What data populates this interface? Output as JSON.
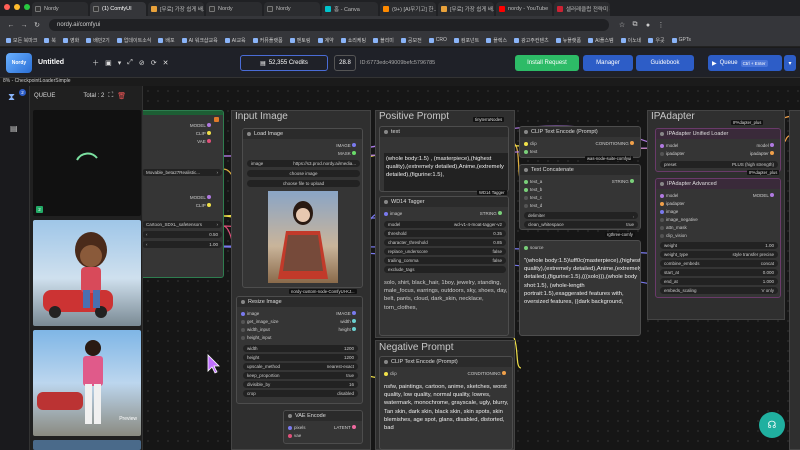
{
  "browser": {
    "tabs": [
      "Nordy",
      "(1) ComfyUI",
      "[무료] 가장 쉽게 배...",
      "Nordy",
      "Nordy",
      "홈 - Canva",
      "(9+) [AI무기고] 한...",
      "[무료] 가장 쉽게 배...",
      "nordy - YouTube",
      "셀러레클럽 전략미 사..."
    ],
    "url": "nordy.ai/comfyui",
    "bookmarks": [
      "모든 북마크",
      "북",
      "영화",
      "배민2기",
      "업데이트소식",
      "배포",
      "AI 워크샵교육",
      "AI교육",
      "커뮤플랫폼",
      "멘토링",
      "계약",
      "쇼리케팅",
      "블리미",
      "공모전",
      "CRO",
      "컴포넌트",
      "플렉스",
      "광고주컨텐츠",
      "뉴플랫폼",
      "AI플스템",
      "이노네",
      "우곳",
      "GPTs"
    ]
  },
  "app": {
    "logo_text": "Nordy",
    "title": "Untitled",
    "credits": "52,355 Credits",
    "zoom": "28.8",
    "id_text": "ID:6773edc49009befc5796785",
    "install_request": "Install Request",
    "manager": "Manager",
    "guidebook": "Guidebook",
    "queue_label": "Queue",
    "queue_shortcut": "Ctrl + Enter",
    "status_line": "8% - CheckpointLoaderSimple"
  },
  "queue_panel": {
    "title": "QUEUE",
    "total": "Total : 2",
    "badge": "2",
    "preview_label": "Preview"
  },
  "nodes": {
    "left_partial": {
      "outputs": [
        "MODEL",
        "CLIP",
        "VAE"
      ],
      "ckpt_value": "Movable_beta27Realistic...",
      "outputs2": [
        "MODEL",
        "CLIP"
      ],
      "ckpt2_value": "Cartoon_SDXL_safetensors",
      "val1": "0.50",
      "val2": "1.00"
    },
    "input_image": {
      "group_title": "Input Image",
      "load_title": "Load Image",
      "outputs": [
        "IMAGE",
        "MASK"
      ],
      "image_label": "image",
      "image_value": "https://s3.prod.nordy.ai/media...",
      "btn_choose": "choose image",
      "btn_upload": "choose file to upload",
      "custom_tag": "nordy-custom-node-ComfyUI-KJ...",
      "resize_title": "Resize Image",
      "resize_inputs": [
        "image",
        "get_image_size",
        "width_input",
        "height_input"
      ],
      "resize_outputs": [
        "IMAGE",
        "width",
        "height"
      ],
      "w_label": "width",
      "w_val": "1200",
      "h_label": "height",
      "h_val": "1200",
      "upscale_label": "upscale_method",
      "upscale_val": "nearest-exact",
      "keep_label": "keep_proportion",
      "keep_val": "true",
      "div_label": "divisible_by",
      "div_val": "16",
      "crop_label": "crop",
      "crop_val": "disabled",
      "vae_title": "VAE Encode",
      "vae_inputs": [
        "pixels",
        "vae"
      ],
      "vae_output": "LATENT"
    },
    "positive": {
      "group_title": "Positive Prompt",
      "text_title": "text",
      "tag": "tinyterraNodes",
      "text": "(whole body:1.5) , (masterpiece),(highest quality),(extremely detailed),Anime,(extremely detailed),(figurine:1.5),",
      "wd14_title": "WD14 Tagger",
      "wd14_tag": "WD14 Tagger",
      "wd_image": "image",
      "wd_output": "STRING",
      "model_label": "model",
      "model_val": "wd-v1-4-moat-tagger-v2",
      "thr_label": "threshold",
      "thr_val": "0.35",
      "cthr_label": "character_threshold",
      "cthr_val": "0.85",
      "rep_label": "replace_underscore",
      "rep_val": "false",
      "trail_label": "trailing_comma",
      "trail_val": "false",
      "excl_label": "exclude_tags",
      "tags_text": "solo, shirt, black_hair, 1boy, jewelry, standing, male_focus, earrings, outdoors, sky, shoes, day, belt, pants, cloud, dark_skin, necklace, torn_clothes,"
    },
    "clip_text_pos": {
      "title": "CLIP Text Encode (Prompt)",
      "input1": "clip",
      "input2": "text",
      "output": "CONDITIONING",
      "tag": "was-node-suite-comfyui"
    },
    "text_concat": {
      "title": "Text Concatenate",
      "inputs": [
        "text_a",
        "text_b",
        "text_c",
        "text_d"
      ],
      "output": "STRING",
      "delim_label": "delimiter",
      "delim_val": ",",
      "clean_label": "clean_whitespace",
      "clean_val": "true",
      "tag": "rgthree-comfy",
      "source": "source",
      "preview": "\"(whole body:1.5)\\uff0c(masterpiece),(highest quality),(extremely detailed),Anime,(extremely detailed),(figurine:1.5),(((solo))),(whole body shot:1.5), (whole-length portrait:1.5),exaggerated features with, oversized features, ((dark background,"
    },
    "negative": {
      "group_title": "Negative Prompt",
      "title": "CLIP Text Encode (Prompt)",
      "input": "clip",
      "output": "CONDITIONING",
      "text": "nsfw, paintings, cartoon, anime, sketches, worst quality, low quality, normal quality, lowres, watermark, monochrome, grayscale, ugly, blurry, Tan skin, dark skin, black skin, skin spots, skin blemishes, age spot, glans, disabled, distorted, bad"
    },
    "ipadapter": {
      "group_title": "IPAdapter",
      "tag": "IPAdapter_plus",
      "loader_title": "IPAdapter Unified Loader",
      "loader_inputs": [
        "model",
        "ipadapter"
      ],
      "loader_outputs": [
        "model",
        "ipadapter"
      ],
      "preset_label": "preset",
      "preset_val": "PLUS (high strength)",
      "tag2": "IPAdapter_plus",
      "adv_title": "IPAdapter Advanced",
      "adv_inputs": [
        "model",
        "ipadapter",
        "image",
        "image_negative",
        "attn_mask",
        "clip_vision"
      ],
      "adv_output": "MODEL",
      "weight_label": "weight",
      "weight_val": "1.00",
      "wtype_label": "weight_type",
      "wtype_val": "style transfer precise",
      "comb_label": "combine_embeds",
      "comb_val": "concat",
      "start_label": "start_at",
      "start_val": "0.000",
      "end_label": "end_at",
      "end_val": "1.000",
      "emb_label": "embeds_scaling",
      "emb_val": "V only"
    }
  }
}
